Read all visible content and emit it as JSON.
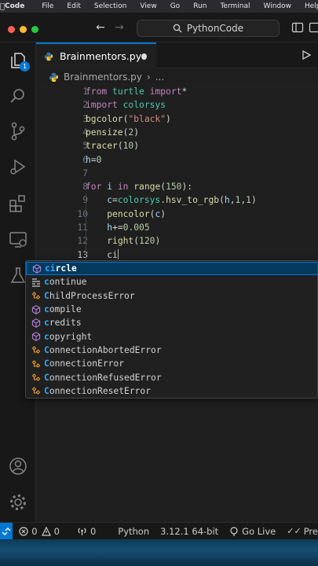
{
  "menubar": {
    "app": "Code",
    "items": [
      "File",
      "Edit",
      "Selection",
      "View",
      "Go",
      "Run",
      "Terminal",
      "Window",
      "Help"
    ]
  },
  "titlebar": {
    "search_text": "PythonCode"
  },
  "activity": {
    "explorer_badge": "1"
  },
  "tab": {
    "filename": "Brainmentors.py"
  },
  "breadcrumb": {
    "file": "Brainmentors.py",
    "more": "..."
  },
  "editor": {
    "line_numbers": [
      "1",
      "2",
      "3",
      "4",
      "5",
      "6",
      "7",
      "8",
      "9",
      "10",
      "11",
      "12",
      "13"
    ],
    "lines": [
      [
        {
          "t": "from",
          "c": "kw"
        },
        {
          "t": " turtle ",
          "c": "mod"
        },
        {
          "t": "import",
          "c": "kw"
        },
        {
          "t": "*",
          "c": "txt"
        }
      ],
      [
        {
          "t": "import",
          "c": "kw"
        },
        {
          "t": " colorsys",
          "c": "mod"
        }
      ],
      [
        {
          "t": "bgcolor",
          "c": "fn"
        },
        {
          "t": "(",
          "c": "txt"
        },
        {
          "t": "\"black\"",
          "c": "str"
        },
        {
          "t": ")",
          "c": "txt"
        }
      ],
      [
        {
          "t": "pensize",
          "c": "fn"
        },
        {
          "t": "(",
          "c": "txt"
        },
        {
          "t": "2",
          "c": "num"
        },
        {
          "t": ")",
          "c": "txt"
        }
      ],
      [
        {
          "t": "tracer",
          "c": "fn"
        },
        {
          "t": "(",
          "c": "txt"
        },
        {
          "t": "10",
          "c": "num"
        },
        {
          "t": ")",
          "c": "txt"
        }
      ],
      [
        {
          "t": "h",
          "c": "var"
        },
        {
          "t": "=",
          "c": "txt"
        },
        {
          "t": "0",
          "c": "num"
        }
      ],
      [],
      [
        {
          "t": "for",
          "c": "kw"
        },
        {
          "t": " i ",
          "c": "var"
        },
        {
          "t": "in",
          "c": "kw"
        },
        {
          "t": " ",
          "c": "txt"
        },
        {
          "t": "range",
          "c": "fn"
        },
        {
          "t": "(",
          "c": "txt"
        },
        {
          "t": "150",
          "c": "num"
        },
        {
          "t": "):",
          "c": "txt"
        }
      ],
      [
        {
          "t": "    c",
          "c": "var"
        },
        {
          "t": "=",
          "c": "txt"
        },
        {
          "t": "colorsys",
          "c": "mod"
        },
        {
          "t": ".",
          "c": "txt"
        },
        {
          "t": "hsv_to_rgb",
          "c": "fn"
        },
        {
          "t": "(",
          "c": "txt"
        },
        {
          "t": "h",
          "c": "var"
        },
        {
          "t": ",",
          "c": "txt"
        },
        {
          "t": "1",
          "c": "num"
        },
        {
          "t": ",",
          "c": "txt"
        },
        {
          "t": "1",
          "c": "num"
        },
        {
          "t": ")",
          "c": "txt"
        }
      ],
      [
        {
          "t": "    ",
          "c": "txt"
        },
        {
          "t": "pencolor",
          "c": "fn"
        },
        {
          "t": "(",
          "c": "txt"
        },
        {
          "t": "c",
          "c": "var"
        },
        {
          "t": ")",
          "c": "txt"
        }
      ],
      [
        {
          "t": "    h",
          "c": "var"
        },
        {
          "t": "+=",
          "c": "txt"
        },
        {
          "t": "0.005",
          "c": "num"
        }
      ],
      [
        {
          "t": "    ",
          "c": "txt"
        },
        {
          "t": "right",
          "c": "fn"
        },
        {
          "t": "(",
          "c": "txt"
        },
        {
          "t": "120",
          "c": "num"
        },
        {
          "t": ")",
          "c": "txt"
        }
      ],
      [
        {
          "t": "    ci",
          "c": "txt"
        }
      ]
    ],
    "current_line": "13"
  },
  "suggestions": [
    {
      "label": "circle",
      "match": "ci",
      "kind": "method"
    },
    {
      "label": "continue",
      "match": "c",
      "kind": "keyword"
    },
    {
      "label": "ChildProcessError",
      "match": "C",
      "kind": "class"
    },
    {
      "label": "compile",
      "match": "c",
      "kind": "method"
    },
    {
      "label": "credits",
      "match": "c",
      "kind": "method"
    },
    {
      "label": "copyright",
      "match": "c",
      "kind": "method"
    },
    {
      "label": "ConnectionAbortedError",
      "match": "C",
      "kind": "class"
    },
    {
      "label": "ConnectionError",
      "match": "C",
      "kind": "class"
    },
    {
      "label": "ConnectionRefusedError",
      "match": "C",
      "kind": "class"
    },
    {
      "label": "ConnectionResetError",
      "match": "C",
      "kind": "class"
    }
  ],
  "statusbar": {
    "errors": "0",
    "warnings": "0",
    "ports": "0",
    "language": "Python",
    "interpreter": "3.12.1 64-bit",
    "go_live": "Go Live",
    "prettier": "Pre"
  },
  "colors": {
    "accent": "#0078d4",
    "editor_bg": "#1f1f1f",
    "keyword": "#c586c0",
    "function": "#dcdcaa",
    "string": "#ce9178",
    "number": "#b5cea8"
  }
}
